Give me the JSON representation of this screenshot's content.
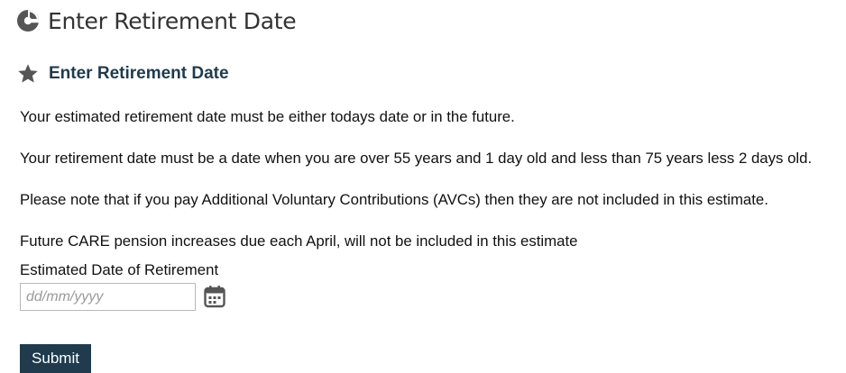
{
  "header": {
    "title": "Enter Retirement Date",
    "logo_icon": "pie-chart-logo-icon"
  },
  "section": {
    "title": "Enter Retirement Date",
    "icon": "star-icon",
    "paragraphs": [
      "Your estimated retirement date must be either todays date or in the future.",
      "Your retirement date must be a date when you are over 55 years and 1 day old and less than 75 years less 2 days old.",
      "Please note that if you pay Additional Voluntary Contributions (AVCs) then they are not included in this estimate.",
      "Future CARE pension increases due each April, will not be included in this estimate"
    ]
  },
  "form": {
    "date_label": "Estimated Date of Retirement",
    "date_placeholder": "dd/mm/yyyy",
    "date_value": "",
    "calendar_icon": "calendar-icon",
    "submit_label": "Submit"
  },
  "colors": {
    "accent": "#1f3b4d",
    "heading_text": "#333333",
    "icon_gray": "#555555",
    "input_border": "#b9b9b9"
  }
}
